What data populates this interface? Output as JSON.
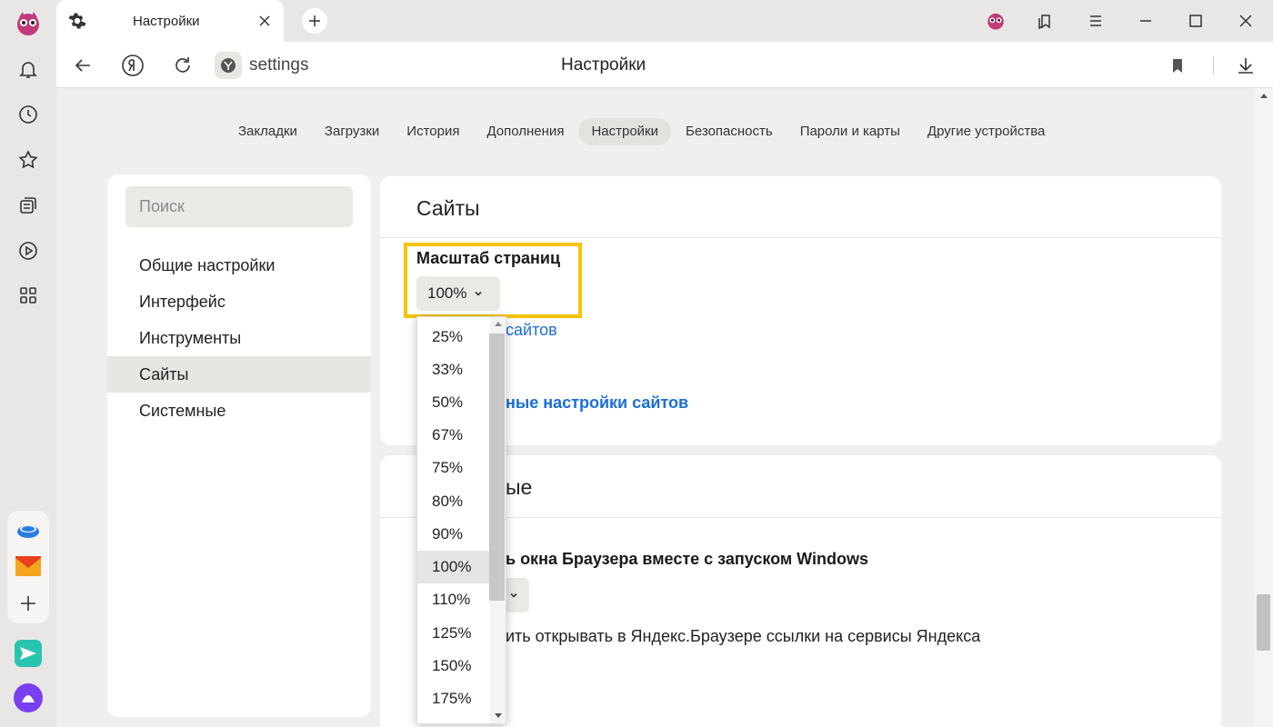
{
  "tab": {
    "title": "Настройки"
  },
  "toolbar": {
    "address": "settings",
    "page_heading": "Настройки"
  },
  "navtabs": [
    "Закладки",
    "Загрузки",
    "История",
    "Дополнения",
    "Настройки",
    "Безопасность",
    "Пароли и карты",
    "Другие устройства"
  ],
  "navtabs_active": "Настройки",
  "menu": {
    "search_placeholder": "Поиск",
    "items": [
      "Общие настройки",
      "Интерфейс",
      "Инструменты",
      "Сайты",
      "Системные"
    ],
    "active": "Сайты"
  },
  "sites_card": {
    "title": "Сайты",
    "zoom_label": "Масштаб страниц",
    "zoom_value": "100%",
    "link_partial": "сайтов",
    "link_advanced_partial": "ные настройки сайтов"
  },
  "system_card": {
    "title_partial": "ые",
    "startup_label_partial": "ь окна Браузера вместе с запуском Windows",
    "yandex_links_partial": "ить открывать в Яндекс.Браузере ссылки на сервисы Яндекса"
  },
  "zoom_options": [
    "25%",
    "33%",
    "50%",
    "67%",
    "75%",
    "80%",
    "90%",
    "100%",
    "110%",
    "125%",
    "150%",
    "175%"
  ],
  "zoom_selected": "100%",
  "colors": {
    "accent_link": "#1a6ed8",
    "highlight": "#f5c400",
    "brand_pink": "#e03c8a"
  },
  "icons": {
    "leftbar": [
      "browser-logo-icon",
      "bell-icon",
      "clock-icon",
      "star-icon",
      "collections-icon",
      "play-icon",
      "apps-icon",
      "disk-icon",
      "mail-icon",
      "add-icon",
      "messenger-icon",
      "alice-icon"
    ]
  }
}
